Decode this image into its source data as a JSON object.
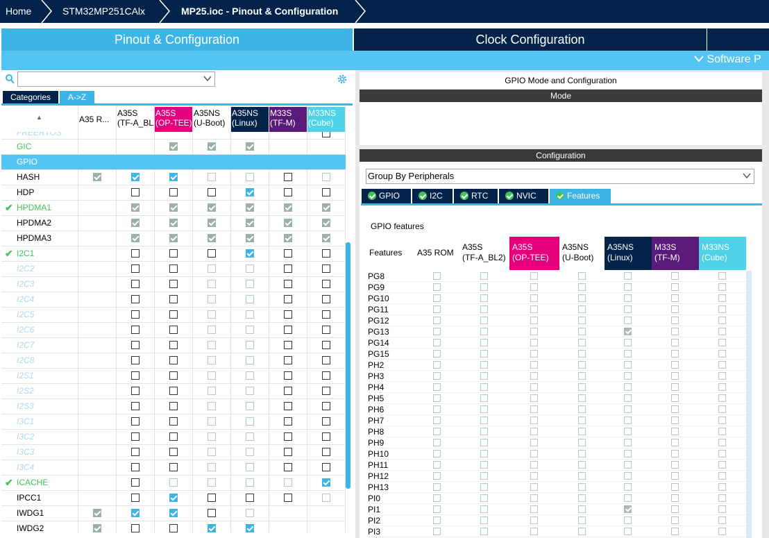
{
  "breadcrumb": {
    "home": "Home",
    "device": "STM32MP251CAlx",
    "project": "MP25.ioc - Pinout & Configuration"
  },
  "tabs": {
    "pinout": "Pinout & Configuration",
    "clock": "Clock Configuration",
    "software_packs": "Software P"
  },
  "left": {
    "tab_categories": "Categories",
    "tab_az": "A->Z",
    "columns": [
      {
        "l1": "A35 R...",
        "l2": "",
        "style": "plain"
      },
      {
        "l1": "A35S",
        "l2": "(TF-A_BL2)",
        "style": "plain"
      },
      {
        "l1": "A35S",
        "l2": "(OP-TEE)",
        "style": "magenta"
      },
      {
        "l1": "A35NS",
        "l2": "(U-Boot)",
        "style": "plain"
      },
      {
        "l1": "A35NS",
        "l2": "(Linux)",
        "style": "navy"
      },
      {
        "l1": "M33S",
        "l2": "(TF-M)",
        "style": "purple"
      },
      {
        "l1": "M33NS",
        "l2": "(Cube)",
        "style": "cyan"
      }
    ],
    "partial_row": "FREERTOS",
    "rows": [
      {
        "name": "GIC",
        "style": "green",
        "cells": [
          "n",
          "n",
          "g",
          "g",
          "g",
          "n",
          "n"
        ]
      },
      {
        "name": "GPIO",
        "style": "selected",
        "cells": [
          "n",
          "n",
          "n",
          "n",
          "n",
          "n",
          "n"
        ]
      },
      {
        "name": "HASH",
        "style": "normal",
        "cells": [
          "g",
          "c",
          "c",
          "d",
          "d",
          "e",
          "d"
        ]
      },
      {
        "name": "HDP",
        "style": "normal",
        "cells": [
          "n",
          "e",
          "e",
          "e",
          "c",
          "e",
          "e"
        ]
      },
      {
        "name": "HPDMA1",
        "style": "greencheck",
        "cells": [
          "n",
          "g",
          "g",
          "g",
          "g",
          "g",
          "g"
        ]
      },
      {
        "name": "HPDMA2",
        "style": "normal",
        "cells": [
          "n",
          "g",
          "g",
          "g",
          "g",
          "g",
          "g"
        ]
      },
      {
        "name": "HPDMA3",
        "style": "normal",
        "cells": [
          "n",
          "g",
          "g",
          "g",
          "g",
          "g",
          "g"
        ]
      },
      {
        "name": "I2C1",
        "style": "greencheck",
        "cells": [
          "n",
          "e",
          "e",
          "e",
          "c",
          "e",
          "e"
        ]
      },
      {
        "name": "I2C2",
        "style": "italic",
        "cells": [
          "n",
          "e",
          "e",
          "d",
          "d",
          "e",
          "e"
        ]
      },
      {
        "name": "I2C3",
        "style": "italic",
        "cells": [
          "n",
          "e",
          "e",
          "d",
          "d",
          "e",
          "e"
        ]
      },
      {
        "name": "I2C4",
        "style": "italic",
        "cells": [
          "n",
          "e",
          "e",
          "d",
          "d",
          "e",
          "e"
        ]
      },
      {
        "name": "I2C5",
        "style": "italic",
        "cells": [
          "n",
          "e",
          "e",
          "d",
          "d",
          "e",
          "e"
        ]
      },
      {
        "name": "I2C6",
        "style": "italic",
        "cells": [
          "n",
          "e",
          "e",
          "d",
          "d",
          "e",
          "e"
        ]
      },
      {
        "name": "I2C7",
        "style": "italic",
        "cells": [
          "n",
          "e",
          "e",
          "d",
          "d",
          "e",
          "e"
        ]
      },
      {
        "name": "I2C8",
        "style": "italic",
        "cells": [
          "n",
          "e",
          "e",
          "d",
          "d",
          "e",
          "e"
        ]
      },
      {
        "name": "I2S1",
        "style": "italic",
        "cells": [
          "n",
          "e",
          "e",
          "d",
          "d",
          "e",
          "e"
        ]
      },
      {
        "name": "I2S2",
        "style": "italic",
        "cells": [
          "n",
          "e",
          "e",
          "d",
          "d",
          "e",
          "e"
        ]
      },
      {
        "name": "I2S3",
        "style": "italic",
        "cells": [
          "n",
          "e",
          "e",
          "d",
          "d",
          "e",
          "e"
        ]
      },
      {
        "name": "I3C1",
        "style": "italic",
        "cells": [
          "n",
          "e",
          "e",
          "d",
          "d",
          "e",
          "e"
        ]
      },
      {
        "name": "I3C2",
        "style": "italic",
        "cells": [
          "n",
          "e",
          "e",
          "d",
          "d",
          "e",
          "e"
        ]
      },
      {
        "name": "I3C3",
        "style": "italic",
        "cells": [
          "n",
          "e",
          "e",
          "d",
          "d",
          "e",
          "e"
        ]
      },
      {
        "name": "I3C4",
        "style": "italic",
        "cells": [
          "n",
          "e",
          "e",
          "d",
          "d",
          "e",
          "e"
        ]
      },
      {
        "name": "ICACHE",
        "style": "greencheck",
        "cells": [
          "n",
          "e",
          "d",
          "d",
          "d",
          "d",
          "c"
        ]
      },
      {
        "name": "IPCC1",
        "style": "normal",
        "cells": [
          "n",
          "e",
          "c",
          "e",
          "e",
          "e",
          "d"
        ]
      },
      {
        "name": "IWDG1",
        "style": "normal",
        "cells": [
          "g",
          "c",
          "c",
          "e",
          "d",
          "n",
          "n"
        ]
      },
      {
        "name": "IWDG2",
        "style": "normal",
        "cells": [
          "g",
          "e",
          "e",
          "c",
          "c",
          "n",
          "n"
        ]
      }
    ]
  },
  "right": {
    "gpio_title": "GPIO Mode and Configuration",
    "mode": "Mode",
    "configuration": "Configuration",
    "group_by": "Group By Peripherals",
    "conf_tabs": [
      "GPIO",
      "I2C",
      "RTC",
      "NVIC",
      "Features"
    ],
    "gpio_features": "GPIO features",
    "feat_columns": [
      {
        "l1": "Features",
        "l2": "",
        "style": "plain"
      },
      {
        "l1": "A35 ROM",
        "l2": "",
        "style": "plain"
      },
      {
        "l1": "A35S",
        "l2": "(TF-A_BL2)",
        "style": "plain"
      },
      {
        "l1": "A35S",
        "l2": "(OP-TEE)",
        "style": "magenta"
      },
      {
        "l1": "A35NS",
        "l2": "(U-Boot)",
        "style": "plain"
      },
      {
        "l1": "A35NS",
        "l2": "(Linux)",
        "style": "navy"
      },
      {
        "l1": "M33S",
        "l2": "(TF-M)",
        "style": "purple"
      },
      {
        "l1": "M33NS",
        "l2": "(Cube)",
        "style": "cyan"
      }
    ],
    "pins": [
      "PG8",
      "PG9",
      "PG10",
      "PG11",
      "PG12",
      "PG13",
      "PG14",
      "PG15",
      "PH2",
      "PH3",
      "PH4",
      "PH5",
      "PH6",
      "PH7",
      "PH8",
      "PH9",
      "PH10",
      "PH11",
      "PH12",
      "PH13",
      "PI0",
      "PI1",
      "PI2",
      "PI3"
    ],
    "checked_pins": [
      "PG13",
      "PI1"
    ]
  },
  "colors": {
    "navy": "#03234b",
    "blue": "#3cb4e6",
    "magenta": "#e6007e",
    "purple": "#5a1a7a",
    "cyan": "#4fd2e8",
    "green": "#42c35a"
  }
}
